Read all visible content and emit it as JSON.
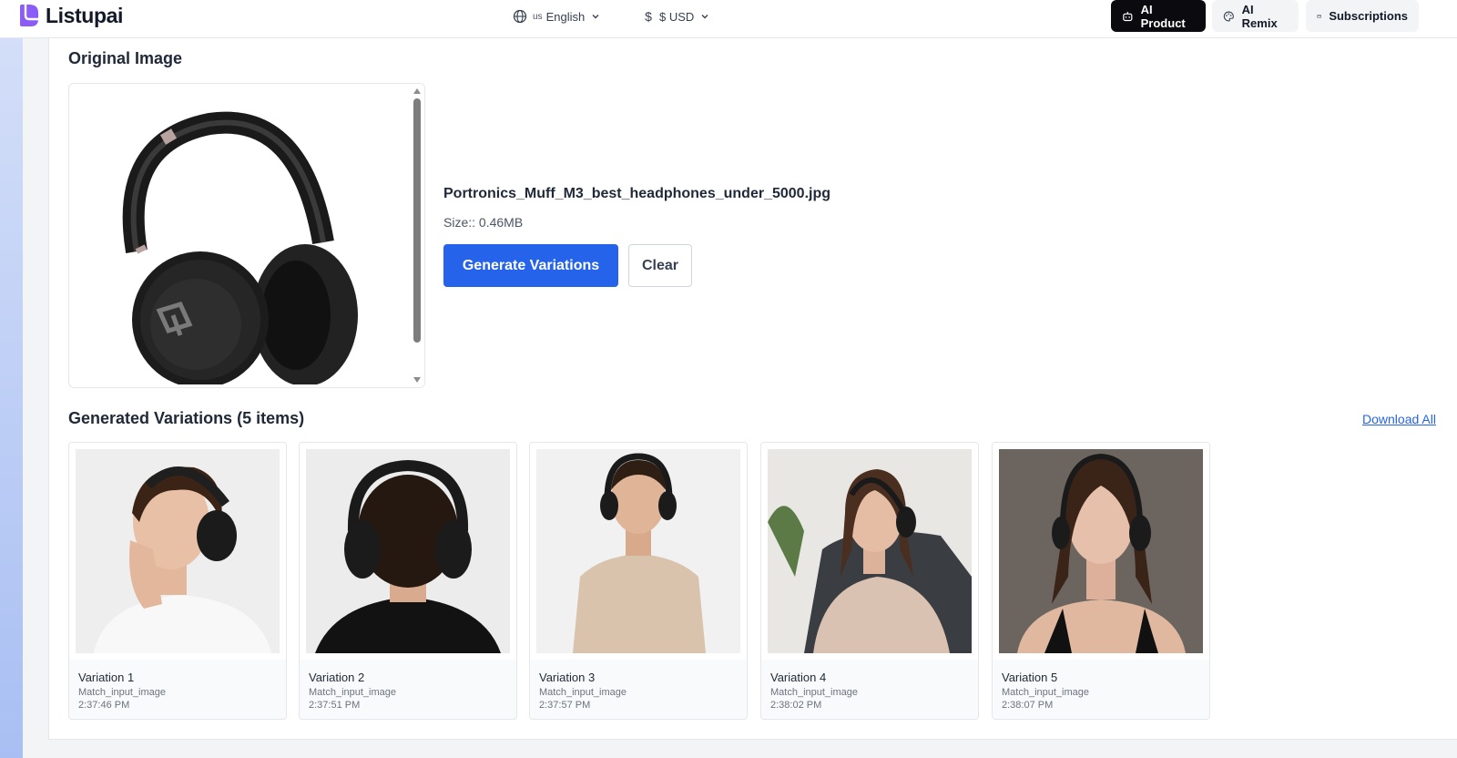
{
  "header": {
    "app_name": "Listupai",
    "language": {
      "flag": "us",
      "label": "English"
    },
    "currency": {
      "label": "$ USD"
    },
    "buttons": {
      "ai_product": "AI Product",
      "ai_remix": "AI Remix",
      "subscriptions": "Subscriptions"
    }
  },
  "original": {
    "section_title": "Original Image",
    "file_name": "Portronics_Muff_M3_best_headphones_under_5000.jpg",
    "file_size": "Size:: 0.46MB",
    "generate_label": "Generate Variations",
    "clear_label": "Clear"
  },
  "variations": {
    "section_title": "Generated Variations (5 items)",
    "download_label": "Download All",
    "items": [
      {
        "title": "Variation 1",
        "mode": "Match_input_image",
        "time": "2:37:46 PM"
      },
      {
        "title": "Variation 2",
        "mode": "Match_input_image",
        "time": "2:37:51 PM"
      },
      {
        "title": "Variation 3",
        "mode": "Match_input_image",
        "time": "2:37:57 PM"
      },
      {
        "title": "Variation 4",
        "mode": "Match_input_image",
        "time": "2:38:02 PM"
      },
      {
        "title": "Variation 5",
        "mode": "Match_input_image",
        "time": "2:38:07 PM"
      }
    ]
  },
  "colors": {
    "primary": "#2563eb",
    "header_dark_button": "#0b0b0f",
    "logo": "#8b5cf6",
    "sidebar_gradient_top": "#d3def8",
    "sidebar_gradient_bottom": "#a9bff3"
  },
  "icons": {
    "language": "globe-icon",
    "currency": "dollar-icon",
    "ai_product": "robot-icon",
    "ai_remix": "palette-icon",
    "subscriptions": "card-icon"
  }
}
